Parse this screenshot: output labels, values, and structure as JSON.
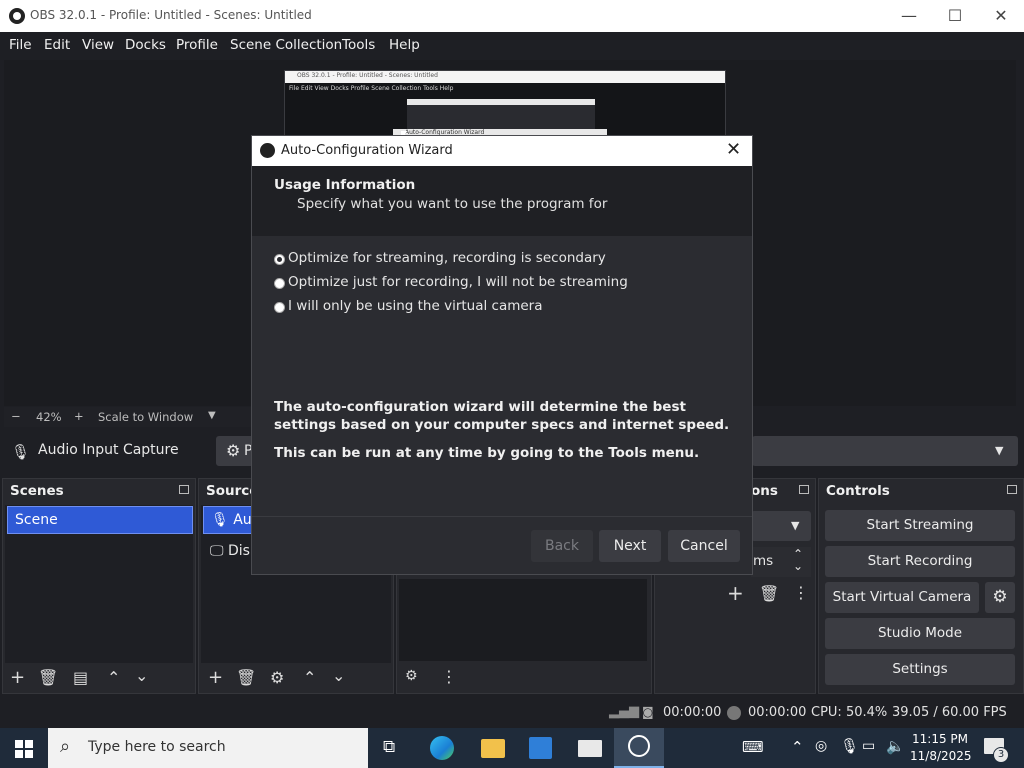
{
  "window": {
    "title": "OBS 32.0.1 - Profile: Untitled - Scenes: Untitled",
    "minimize": "—",
    "maximize": "☐",
    "close": "✕"
  },
  "menu": [
    "File",
    "Edit",
    "View",
    "Docks",
    "Profile",
    "Scene Collection",
    "Tools",
    "Help"
  ],
  "nested_preview": {
    "title": "OBS 32.0.1 - Profile: Untitled - Scenes: Untitled",
    "menu": "File  Edit  View  Docks  Profile  Scene Collection  Tools  Help",
    "inner_title": "Auto-Configuration Wizard"
  },
  "zoom": {
    "minus": "−",
    "value": "42%",
    "plus": "+",
    "mode": "Scale to Window"
  },
  "sources_toolbar": {
    "selected_source": "Audio Input Capture",
    "props_partial": "P"
  },
  "scenes": {
    "title": "Scenes",
    "items": [
      "Scene"
    ]
  },
  "sources": {
    "title": "Source",
    "items": [
      "Aud",
      "Disp"
    ]
  },
  "transitions": {
    "title": "ons",
    "duration_partial": "ms"
  },
  "controls": {
    "title": "Controls",
    "buttons": [
      "Start Streaming",
      "Start Recording",
      "Start Virtual Camera",
      "Studio Mode",
      "Settings"
    ]
  },
  "status": {
    "stream_time": "00:00:00",
    "rec_time": "00:00:00",
    "cpu": "CPU: 50.4%",
    "fps": "39.05 / 60.00 FPS"
  },
  "dialog": {
    "title": "Auto-Configuration Wizard",
    "heading": "Usage Information",
    "subheading": "Specify what you want to use the program for",
    "options": [
      "Optimize for streaming, recording is secondary",
      "Optimize just for recording, I will not be streaming",
      "I will only be using the virtual camera"
    ],
    "selected_index": 0,
    "info1": "The auto-configuration wizard will determine the best settings based on your computer specs and internet speed.",
    "info2": "This can be run at any time by going to the Tools menu.",
    "back": "Back",
    "next": "Next",
    "cancel": "Cancel"
  },
  "taskbar": {
    "search_placeholder": "Type here to search",
    "time": "11:15 PM",
    "date": "11/8/2025",
    "notifications": "3"
  }
}
